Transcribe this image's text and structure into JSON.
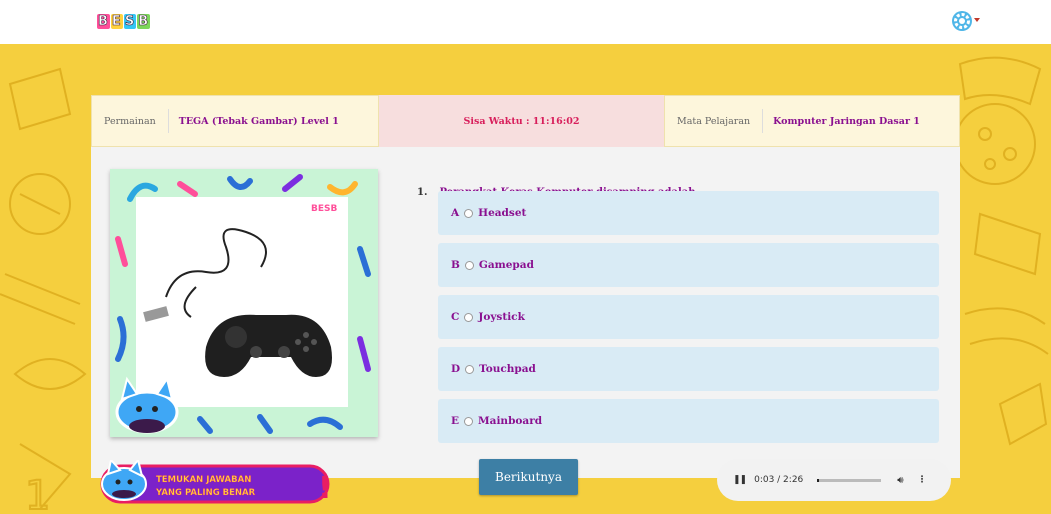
{
  "app": {
    "logo_text": "BESB"
  },
  "header": {
    "settings_icon": "gear-icon",
    "dropdown_icon": "caret-down-icon"
  },
  "info": {
    "game_label": "Permainan",
    "game_value": "TEGA (Tebak Gambar) Level 1",
    "timer": "Sisa Waktu : 11:16:02",
    "subject_label": "Mata Pelajaran",
    "subject_value": "Komputer Jaringan Dasar 1"
  },
  "question": {
    "number": "1.",
    "text": "Perangkat Keras Komputer disamping adalah ....",
    "image_logo": "BESB",
    "image_subject": "gamepad-photo",
    "options": [
      {
        "letter": "A",
        "label": "Headset"
      },
      {
        "letter": "B",
        "label": "Gamepad"
      },
      {
        "letter": "C",
        "label": "Joystick"
      },
      {
        "letter": "D",
        "label": "Touchpad"
      },
      {
        "letter": "E",
        "label": "Mainboard"
      }
    ]
  },
  "banner": {
    "line1": "TEMUKAN JAWABAN",
    "line2": "YANG PALING BENAR",
    "mark": "!"
  },
  "footer": {
    "next_label": "Berikutnya"
  },
  "audio": {
    "time": "0:03 / 2:26",
    "progress": 0.02,
    "pause_icon": "pause-icon",
    "volume_icon": "volume-icon",
    "more_icon": "more-vert-icon"
  },
  "colors": {
    "accent": "#8a1090",
    "timer": "#d81e5b",
    "button": "#3d7fa5",
    "background": "#f5cf3e",
    "option_bg": "#d9ebf5"
  }
}
